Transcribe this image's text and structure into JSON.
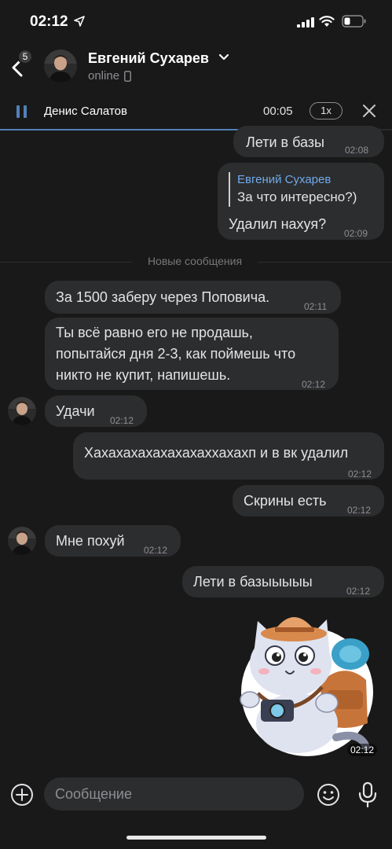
{
  "status_bar": {
    "time": "02:12"
  },
  "header": {
    "back_badge": "5",
    "contact_name": "Евгений Сухарев",
    "contact_status": "online"
  },
  "player": {
    "track": "Денис Салатов",
    "time": "00:05",
    "speed": "1x",
    "progress": 0.71
  },
  "messages": {
    "m1": {
      "text": "Лети в базы",
      "time": "02:08"
    },
    "m2": {
      "reply_author": "Евгений Сухарев",
      "reply_text": "За что интересно?)",
      "text": "Удалил нахуя?",
      "time": "02:09"
    },
    "divider": "Новые сообщения",
    "m3": {
      "text": "За 1500 заберу через Поповича.",
      "time": "02:11"
    },
    "m4": {
      "line1": "Ты всё равно его не продашь,",
      "line2": "попытайся дня 2-3, как поймешь что",
      "line3": "никто не купит, напишешь.",
      "time": "02:12"
    },
    "m5": {
      "text": "Удачи",
      "time": "02:12"
    },
    "m6": {
      "text": "Хахахахахахахахаххахахп и в вк удалил",
      "time": "02:12"
    },
    "m7": {
      "text": "Скрины есть",
      "time": "02:12"
    },
    "m8": {
      "text": "Мне похуй",
      "time": "02:12"
    },
    "m9": {
      "text": "Лети в базыыыыы",
      "time": "02:12"
    },
    "sticker_time": "02:12"
  },
  "composer": {
    "placeholder": "Сообщение"
  },
  "colors": {
    "accent": "#5181b8",
    "bubble": "#2c2d2e",
    "background": "#191919",
    "reply_author": "#71aaeb"
  },
  "icons": [
    "location-arrow-icon",
    "signal-icon",
    "wifi-icon",
    "battery-icon",
    "back-arrow-icon",
    "chevron-down-icon",
    "phone-icon",
    "pause-icon",
    "close-icon",
    "plus-icon",
    "smile-icon",
    "microphone-icon"
  ]
}
